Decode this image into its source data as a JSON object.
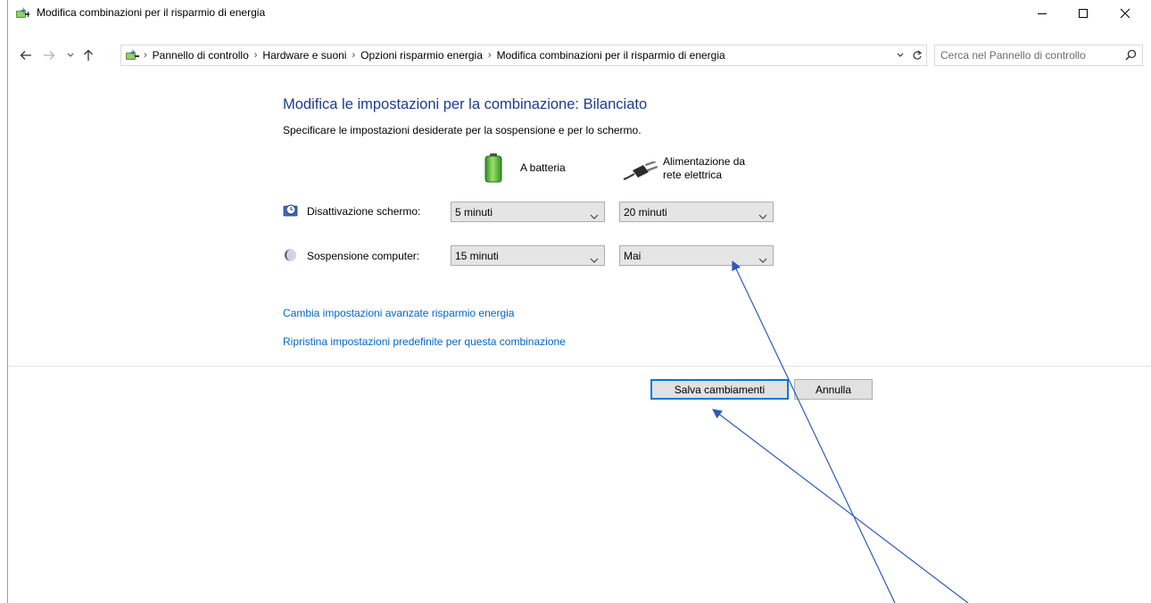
{
  "window": {
    "title": "Modifica combinazioni per il risparmio di energia"
  },
  "address": {
    "crumbs": [
      "Pannello di controllo",
      "Hardware e suoni",
      "Opzioni risparmio energia",
      "Modifica combinazioni per il risparmio di energia"
    ]
  },
  "search": {
    "placeholder": "Cerca nel Pannello di controllo"
  },
  "content": {
    "heading": "Modifica le impostazioni per la combinazione: Bilanciato",
    "subtitle": "Specificare le impostazioni desiderate per la sospensione e per lo schermo.",
    "col_battery": "A batteria",
    "col_ac_line1": "Alimentazione da",
    "col_ac_line2": "rete elettrica",
    "rows": [
      {
        "label": "Disattivazione schermo:",
        "battery": "5 minuti",
        "ac": "20 minuti"
      },
      {
        "label": "Sospensione computer:",
        "battery": "15 minuti",
        "ac": "Mai"
      }
    ],
    "link_advanced": "Cambia impostazioni avanzate risparmio energia",
    "link_restore": "Ripristina impostazioni predefinite per questa combinazione"
  },
  "buttons": {
    "save": "Salva cambiamenti",
    "cancel": "Annulla"
  },
  "colors": {
    "heading": "#1e3c8c",
    "link": "#0066cc",
    "focus_border": "#0078d7",
    "annotation_arrow": "#2e5bb8"
  }
}
